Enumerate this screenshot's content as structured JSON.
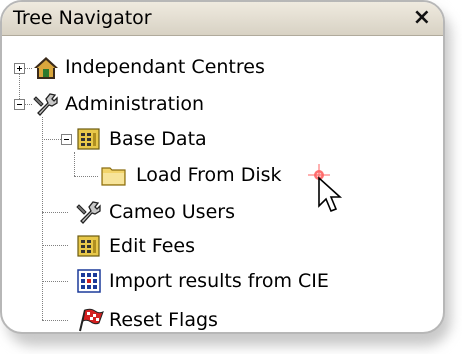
{
  "window": {
    "title": "Tree Navigator",
    "close_label": "×"
  },
  "tree": {
    "nodes": [
      {
        "label": "Independant Centres",
        "icon": "house-icon",
        "state": "collapsed"
      },
      {
        "label": "Administration",
        "icon": "wrench-icon",
        "state": "expanded"
      },
      {
        "label": "Base Data",
        "icon": "grid-icon",
        "state": "expanded"
      },
      {
        "label": "Load From Disk",
        "icon": "folder-icon",
        "state": "leaf"
      },
      {
        "label": "Cameo Users",
        "icon": "wrench-icon",
        "state": "leaf"
      },
      {
        "label": "Edit Fees",
        "icon": "grid-icon",
        "state": "leaf"
      },
      {
        "label": "Import results from CIE",
        "icon": "import-grid-icon",
        "state": "leaf"
      },
      {
        "label": "Reset Flags",
        "icon": "checkered-flag-icon",
        "state": "leaf"
      }
    ]
  }
}
